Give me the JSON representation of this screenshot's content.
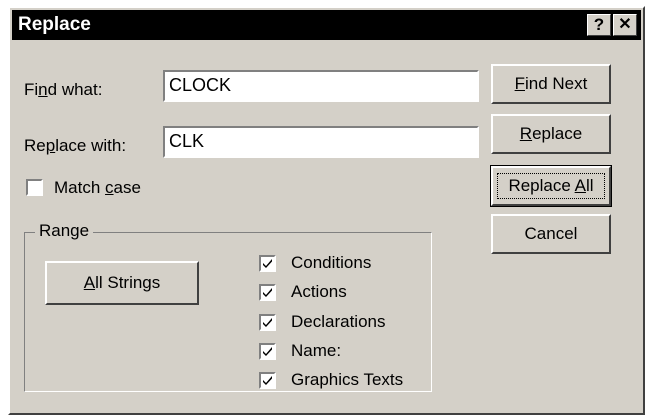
{
  "window": {
    "title": "Replace",
    "help_btn": "?",
    "close_btn": "✕"
  },
  "find": {
    "label_pre": "Fi",
    "label_key": "n",
    "label_post": "d what:",
    "value": "CLOCK"
  },
  "replace": {
    "label_pre": "Re",
    "label_key": "p",
    "label_post": "lace with:",
    "value": "CLK"
  },
  "match_case": {
    "label_pre": "Match ",
    "label_key": "c",
    "label_post": "ase",
    "checked": false
  },
  "range": {
    "legend": "Range",
    "all_strings_pre": "",
    "all_strings_key": "A",
    "all_strings_post": "ll Strings",
    "options": [
      {
        "label": "Conditions",
        "checked": true
      },
      {
        "label": "Actions",
        "checked": true
      },
      {
        "label": "Declarations",
        "checked": true
      },
      {
        "label": "Name:",
        "checked": true
      },
      {
        "label": "Graphics Texts",
        "checked": true
      }
    ]
  },
  "buttons": {
    "find_next_key": "F",
    "find_next_post": "ind Next",
    "replace_key": "R",
    "replace_post": "eplace",
    "replace_all_pre": "Replace ",
    "replace_all_key": "A",
    "replace_all_post": "ll",
    "cancel": "Cancel"
  }
}
